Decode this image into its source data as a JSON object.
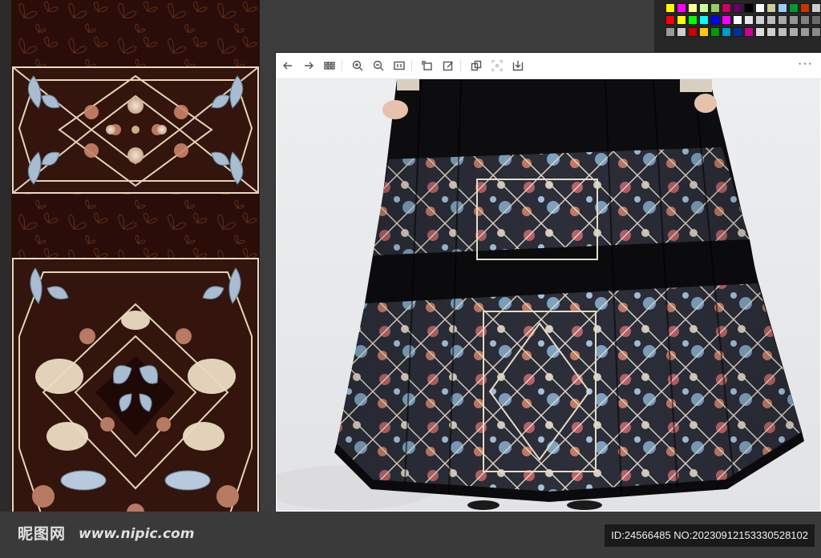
{
  "watermark": {
    "site_name": "昵图网",
    "site_url": "www.nipic.com",
    "image_id": "ID:24566485 NO:20230912153330528102"
  },
  "viewer": {
    "toolbar": {
      "back": "back-icon",
      "forward": "forward-icon",
      "grid": "grid-view-icon",
      "zoom_in": "zoom-in-icon",
      "zoom_out": "zoom-out-icon",
      "fit": "actual-size-icon",
      "rotate": "rotate-icon",
      "edit": "edit-icon",
      "copy": "copy-icon",
      "crop": "crop-icon",
      "save": "download-icon",
      "more": "···"
    }
  },
  "palette": {
    "row1": [
      "#ffff00",
      "#ff00ff",
      "#ffff99",
      "#ccff99",
      "#99cc66",
      "#cc0066",
      "#660066",
      "#000000",
      "#ffffff",
      "#cccc99",
      "#99ccff",
      "#009933",
      "#cc3300",
      "#cccccc"
    ],
    "row2": [
      "#ff0000",
      "#ffff00",
      "#00ff00",
      "#00ffff",
      "#0000ff",
      "#ff00ff",
      "#ffffff",
      "#e6e6e6",
      "#d0d0d0",
      "#bdbdbd",
      "#a8a8a8",
      "#959595",
      "#808080",
      "#6b6b6b"
    ],
    "row3": [
      "#999999",
      "#cccccc",
      "#cc0000",
      "#ffcc00",
      "#009900",
      "#0099cc",
      "#003399",
      "#cc0099",
      "#dddddd",
      "#cfcfcf",
      "#bdbdbd",
      "#adadad",
      "#9b9b9b",
      "#8a8a8a"
    ]
  }
}
